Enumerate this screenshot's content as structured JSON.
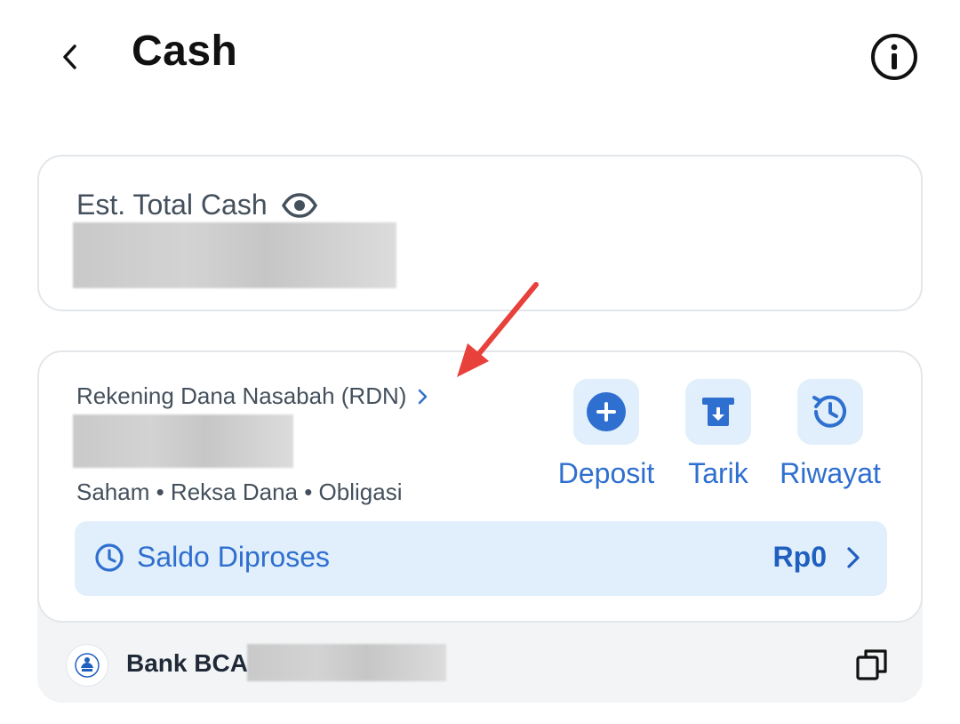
{
  "header": {
    "title": "Cash"
  },
  "total": {
    "label": "Est. Total Cash"
  },
  "rdn": {
    "link_label": "Rekening Dana Nasabah (RDN)",
    "products": "Saham • Reksa Dana • Obligasi",
    "actions": [
      {
        "label": "Deposit",
        "icon": "plus-circle-icon"
      },
      {
        "label": "Tarik",
        "icon": "atm-withdraw-icon"
      },
      {
        "label": "Riwayat",
        "icon": "history-icon"
      }
    ],
    "saldo": {
      "label": "Saldo Diproses",
      "amount": "Rp0"
    }
  },
  "bank": {
    "name": "Bank BCA"
  },
  "colors": {
    "accent": "#2f6fcf",
    "accent_bg": "#e0effb",
    "annotation_arrow": "#e8413c"
  }
}
